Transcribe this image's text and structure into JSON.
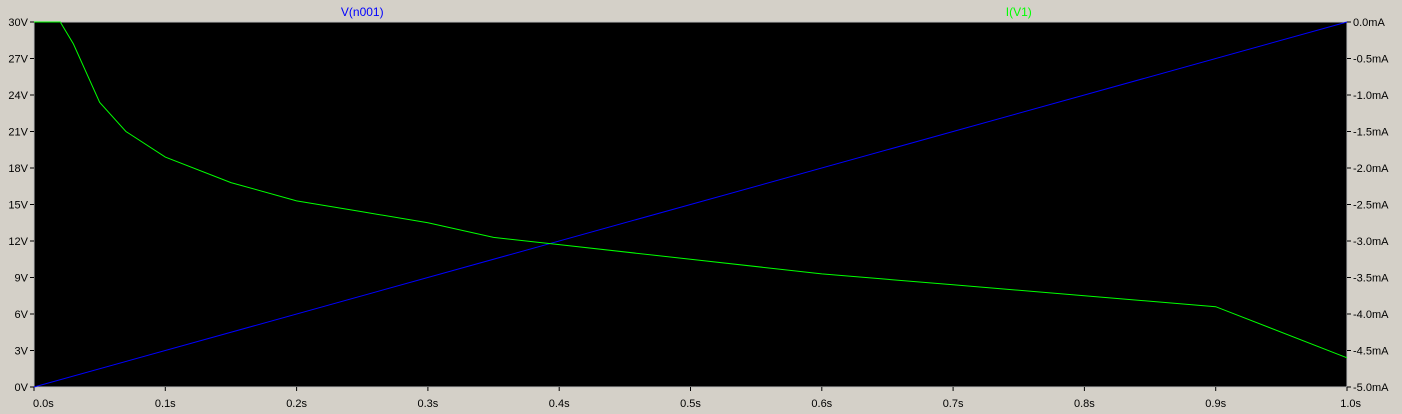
{
  "chart_data": {
    "type": "line",
    "colors": {
      "background": "#000000",
      "frame": "#d4d0c8",
      "axis": "#c0c0c0",
      "voltage_trace": "#0000ff",
      "current_trace": "#00ff00"
    },
    "series": [
      {
        "name": "V(n001)",
        "axis": "left",
        "x": [
          0.0,
          1.0
        ],
        "values": [
          0,
          30
        ]
      },
      {
        "name": "I(V1)",
        "axis": "right",
        "x": [
          0.0,
          0.02,
          0.03,
          0.05,
          0.07,
          0.1,
          0.15,
          0.2,
          0.25,
          0.3,
          0.35,
          0.4,
          0.5,
          0.6,
          0.7,
          0.8,
          0.9,
          1.0
        ],
        "values": [
          0.0,
          0.0,
          -0.3,
          -1.1,
          -1.5,
          -1.85,
          -2.2,
          -2.45,
          -2.6,
          -2.75,
          -2.95,
          -3.05,
          -3.25,
          -3.45,
          -3.6,
          -3.75,
          -3.9,
          -4.6
        ]
      }
    ],
    "x_axis": {
      "range": [
        0.0,
        1.0
      ],
      "ticks": [
        0,
        0.1,
        0.2,
        0.3,
        0.4,
        0.5,
        0.6,
        0.7,
        0.8,
        0.9,
        1.0
      ],
      "tick_labels": [
        "0.0s",
        "0.1s",
        "0.2s",
        "0.3s",
        "0.4s",
        "0.5s",
        "0.6s",
        "0.7s",
        "0.8s",
        "0.9s",
        "1.0s"
      ]
    },
    "y_left": {
      "range": [
        0,
        30
      ],
      "ticks": [
        0,
        3,
        6,
        9,
        12,
        15,
        18,
        21,
        24,
        27,
        30
      ],
      "tick_labels": [
        "0V",
        "3V",
        "6V",
        "9V",
        "12V",
        "15V",
        "18V",
        "21V",
        "24V",
        "27V",
        "30V"
      ]
    },
    "y_right": {
      "range": [
        -5.0,
        0.0
      ],
      "ticks": [
        -5.0,
        -4.5,
        -4.0,
        -3.5,
        -3.0,
        -2.5,
        -2.0,
        -1.5,
        -1.0,
        -0.5,
        0.0
      ],
      "tick_labels": [
        "-5.0mA",
        "-4.5mA",
        "-4.0mA",
        "-3.5mA",
        "-3.0mA",
        "-2.5mA",
        "-2.0mA",
        "-1.5mA",
        "-1.0mA",
        "-0.5mA",
        "0.0mA"
      ]
    },
    "grid": false
  }
}
